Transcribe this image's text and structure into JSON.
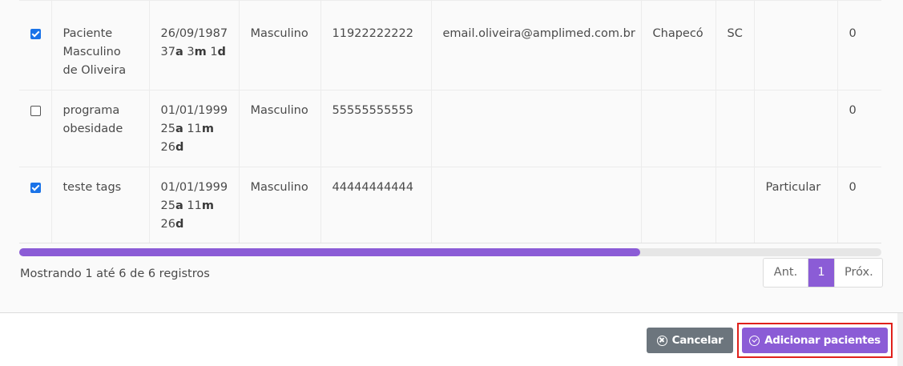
{
  "table": {
    "rows": [
      {
        "checked": true,
        "name": "Paciente Masculino de Oliveira",
        "dob": "26/09/1987",
        "age": {
          "years": "37",
          "y_unit": "a",
          "months": "3",
          "m_unit": "m",
          "days": "1",
          "d_unit": "d"
        },
        "gender": "Masculino",
        "phone": "11922222222",
        "email": "email.oliveira@amplimed.com.br",
        "city": "Chapecó",
        "state": "SC",
        "plan": "",
        "count": "0"
      },
      {
        "checked": false,
        "name": "programa obesidade",
        "dob": "01/01/1999",
        "age": {
          "years": "25",
          "y_unit": "a",
          "months": "11",
          "m_unit": "m",
          "days": "26",
          "d_unit": "d"
        },
        "gender": "Masculino",
        "phone": "55555555555",
        "email": "",
        "city": "",
        "state": "",
        "plan": "",
        "count": "0"
      },
      {
        "checked": true,
        "name": "teste tags",
        "dob": "01/01/1999",
        "age": {
          "years": "25",
          "y_unit": "a",
          "months": "11",
          "m_unit": "m",
          "days": "26",
          "d_unit": "d"
        },
        "gender": "Masculino",
        "phone": "44444444444",
        "email": "",
        "city": "",
        "state": "",
        "plan": "Particular",
        "count": "0"
      }
    ]
  },
  "scrollbar": {
    "position_fraction": 0.72
  },
  "footer": {
    "showing_text": "Mostrando 1 até 6 de 6 registros",
    "pager": {
      "prev": "Ant.",
      "current": "1",
      "next": "Próx."
    }
  },
  "actions": {
    "cancel_label": "Cancelar",
    "add_label": "Adicionar pacientes"
  },
  "colors": {
    "accent": "#8b5cd6",
    "cancel": "#6c757d",
    "highlight": "#e0201b",
    "checkbox": "#1a73e8"
  }
}
